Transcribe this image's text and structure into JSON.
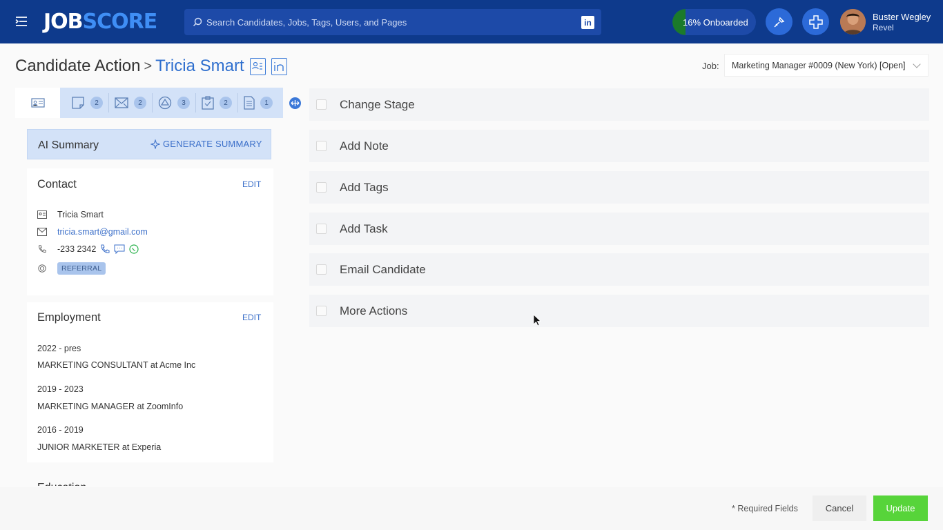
{
  "header": {
    "logo_part1": "JOB",
    "logo_part2": "SCORE",
    "search_placeholder": "Search Candidates, Jobs, Tags, Users, and Pages",
    "linkedin_label": "in",
    "onboarded_label": "16% Onboarded",
    "onboarded_fraction": 0.16,
    "user_name": "Buster Wegley",
    "user_org": "Revel"
  },
  "page": {
    "breadcrumb_root": "Candidate Action",
    "breadcrumb_sep": ">",
    "candidate_name": "Tricia Smart",
    "job_label": "Job:",
    "job_value": "Marketing Manager #0009 (New York) [Open]"
  },
  "tabs": [
    {
      "icon": "notes-icon",
      "count": "2"
    },
    {
      "icon": "mail-icon",
      "count": "2"
    },
    {
      "icon": "stages-icon",
      "count": "3"
    },
    {
      "icon": "tasks-icon",
      "count": "2"
    },
    {
      "icon": "document-icon",
      "count": "1"
    }
  ],
  "ai_summary": {
    "title": "AI Summary",
    "generate_label": "GENERATE SUMMARY"
  },
  "contact": {
    "title": "Contact",
    "edit_label": "EDIT",
    "name": "Tricia Smart",
    "email": "tricia.smart@gmail.com",
    "phone": "-233 2342",
    "source_badge": "REFERRAL"
  },
  "employment": {
    "title": "Employment",
    "edit_label": "EDIT",
    "entries": [
      {
        "years": "2022 - pres",
        "role": "MARKETING CONSULTANT at Acme Inc"
      },
      {
        "years": "2019 - 2023",
        "role": "MARKETING MANAGER at ZoomInfo"
      },
      {
        "years": "2016 - 2019",
        "role": "JUNIOR MARKETER at Experia"
      }
    ]
  },
  "education": {
    "title": "Education"
  },
  "actions": [
    "Change Stage",
    "Add Note",
    "Add Tags",
    "Add Task",
    "Email Candidate",
    "More Actions"
  ],
  "footer": {
    "required_label": "* Required Fields",
    "cancel_label": "Cancel",
    "update_label": "Update"
  },
  "colors": {
    "topbar": "#0e3a8c",
    "accent_blue": "#2f6fce",
    "update_green": "#57d43a",
    "onboard_green": "#1b7a2a"
  }
}
